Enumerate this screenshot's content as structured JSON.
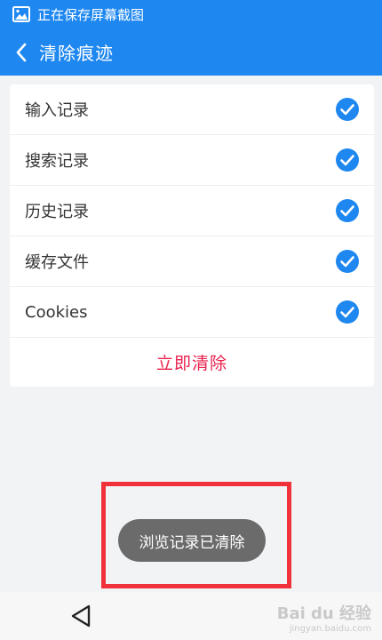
{
  "status_bar": {
    "icon": "image-icon",
    "text": "正在保存屏幕截图"
  },
  "header": {
    "back_icon": "chevron-left-icon",
    "title": "清除痕迹"
  },
  "options": [
    {
      "label": "输入记录",
      "checked": true
    },
    {
      "label": "搜索记录",
      "checked": true
    },
    {
      "label": "历史记录",
      "checked": true
    },
    {
      "label": "缓存文件",
      "checked": true
    },
    {
      "label": "Cookies",
      "checked": true
    }
  ],
  "clear_button": {
    "label": "立即清除"
  },
  "toast": {
    "text": "浏览记录已清除"
  },
  "bottom_nav": {
    "back_icon": "triangle-back-icon"
  },
  "watermark": {
    "brand": "Bai du 经验",
    "url": "jingyan.baidu.com"
  },
  "colors": {
    "primary": "#1f88f0",
    "accent_red": "#e8214d",
    "highlight": "#f0313a",
    "check": "#1f88f0"
  }
}
